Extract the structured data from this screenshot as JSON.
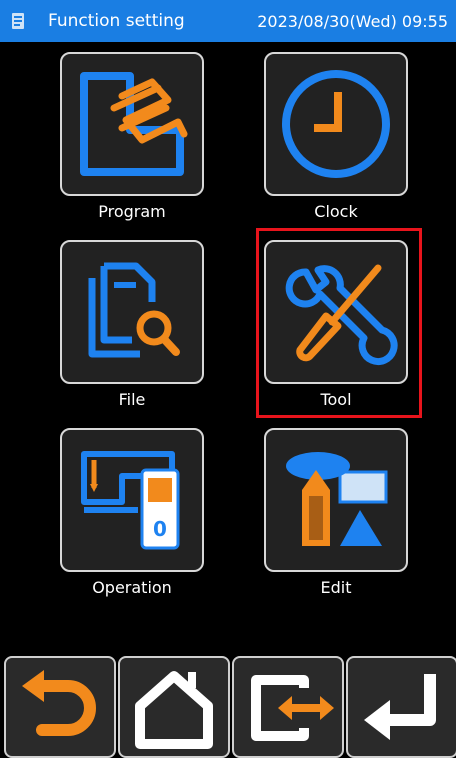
{
  "header": {
    "title": "Function setting",
    "datetime": "2023/08/30(Wed) 09:55",
    "app_icon": "memo-icon"
  },
  "menu": {
    "items": [
      {
        "label": "Program",
        "icon": "program-icon"
      },
      {
        "label": "Clock",
        "icon": "clock-icon"
      },
      {
        "label": "File",
        "icon": "file-search-icon"
      },
      {
        "label": "Tool",
        "icon": "tool-icon",
        "highlighted": true
      },
      {
        "label": "Operation",
        "icon": "operation-icon"
      },
      {
        "label": "Edit",
        "icon": "edit-icon"
      }
    ],
    "highlight_color": "#e8141c"
  },
  "nav": {
    "buttons": [
      {
        "icon": "back-icon"
      },
      {
        "icon": "home-icon"
      },
      {
        "icon": "switch-icon"
      },
      {
        "icon": "enter-icon"
      }
    ]
  },
  "colors": {
    "header_bg": "#1a7ee3",
    "accent_orange": "#f28a1c",
    "accent_blue": "#1e82f0"
  }
}
